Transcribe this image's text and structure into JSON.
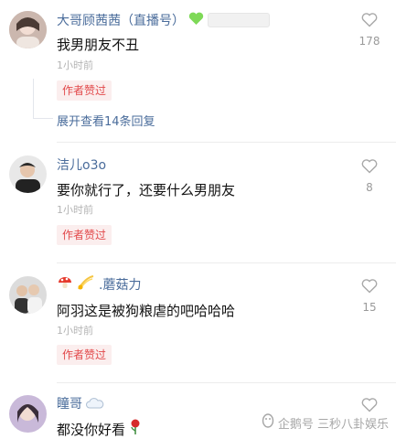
{
  "liked_badge_label": "作者赞过",
  "comments": [
    {
      "username": "大哥顾茜茜（直播号）",
      "badge_icon": "green-heart-icon",
      "text": "我男朋友不丑",
      "time": "1小时前",
      "liked_by_author": true,
      "likes": "178",
      "expand_label": "展开查看14条回复"
    },
    {
      "username": "洁儿o3o",
      "text": "要你就行了，还要什么男朋友",
      "time": "1小时前",
      "liked_by_author": true,
      "likes": "8"
    },
    {
      "username": ".蘑菇力",
      "name_prefix_icons": [
        "mushroom-icon",
        "comet-icon"
      ],
      "text": "阿羽这是被狗粮虐的吧哈哈哈",
      "time": "1小时前",
      "liked_by_author": true,
      "likes": "15"
    },
    {
      "username": "瞳哥",
      "name_suffix_icon": "cloud-icon",
      "text": "都没你好看",
      "text_suffix_icon": "rose-icon",
      "likes": ""
    }
  ],
  "watermark": {
    "text": "企鹅号 三秒八卦娱乐"
  },
  "colors": {
    "username": "#4a6c9b",
    "badge_bg": "#fbeeee",
    "badge_text": "#e2484a"
  }
}
